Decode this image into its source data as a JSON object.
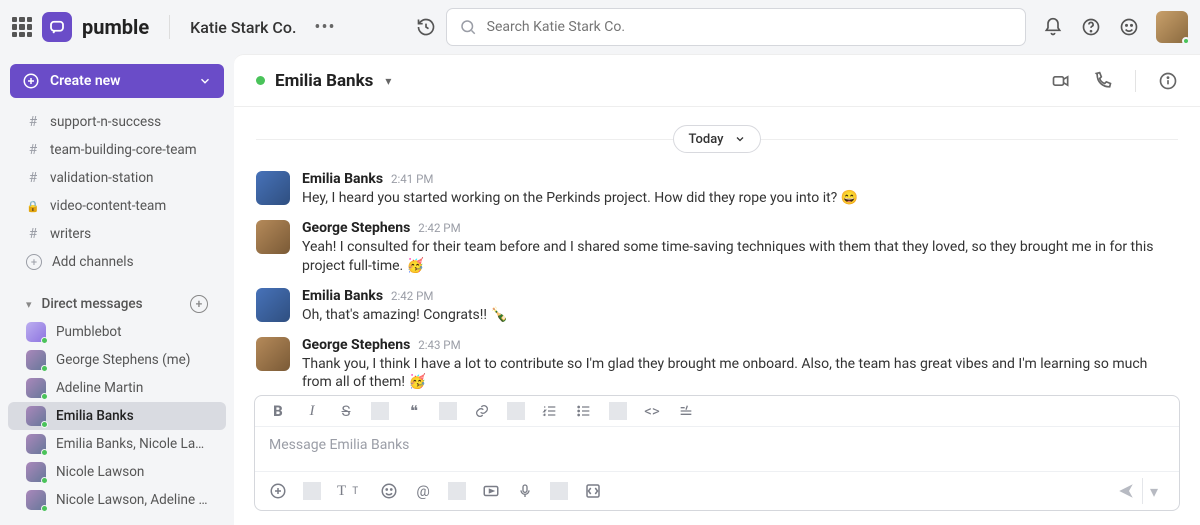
{
  "brand": {
    "name": "pumble"
  },
  "workspace": {
    "name": "Katie Stark Co."
  },
  "search": {
    "placeholder": "Search Katie Stark Co."
  },
  "sidebar": {
    "create_label": "Create new",
    "channels": [
      {
        "type": "public",
        "name": "support-n-success"
      },
      {
        "type": "public",
        "name": "team-building-core-team"
      },
      {
        "type": "public",
        "name": "validation-station"
      },
      {
        "type": "private",
        "name": "video-content-team"
      },
      {
        "type": "public",
        "name": "writers"
      }
    ],
    "add_channels_label": "Add channels",
    "dm_section_label": "Direct messages",
    "dms": [
      {
        "name": "Pumblebot",
        "bot": true
      },
      {
        "name": "George Stephens (me)"
      },
      {
        "name": "Adeline Martin"
      },
      {
        "name": "Emilia Banks",
        "active": true
      },
      {
        "name": "Emilia Banks, Nicole Lawson"
      },
      {
        "name": "Nicole Lawson"
      },
      {
        "name": "Nicole Lawson, Adeline Mar..."
      }
    ]
  },
  "chat": {
    "title": "Emilia Banks",
    "date_label": "Today",
    "messages": [
      {
        "author": "Emilia Banks",
        "time": "2:41 PM",
        "avatar": "e",
        "text": "Hey, I heard you started working on the Perkinds project. How did they rope you into it? 😄"
      },
      {
        "author": "George Stephens",
        "time": "2:42 PM",
        "avatar": "g",
        "text": "Yeah! I consulted for their team before and I shared some time-saving techniques with them that they loved, so they brought me in for this project full-time. 🥳"
      },
      {
        "author": "Emilia Banks",
        "time": "2:42 PM",
        "avatar": "e",
        "text": "Oh, that's amazing! Congrats!! 🍾"
      },
      {
        "author": "George Stephens",
        "time": "2:43 PM",
        "avatar": "g",
        "text": "Thank you, I think I have a lot to contribute so I'm glad they brought me onboard. Also, the team has great vibes and I'm learning so much from all of them! 🥳"
      }
    ]
  },
  "composer": {
    "placeholder": "Message Emilia Banks"
  }
}
